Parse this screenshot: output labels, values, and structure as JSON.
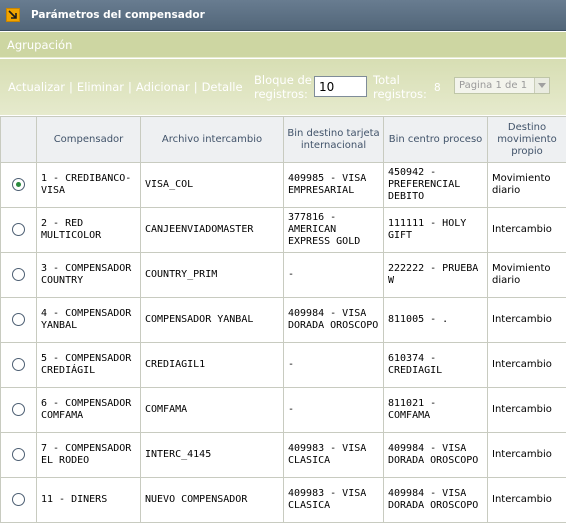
{
  "window": {
    "title": "Parámetros del compensador",
    "icon": "corner-arrow-icon"
  },
  "grouping": {
    "label": "Agrupación"
  },
  "toolbar": {
    "actualizar": "Actualizar",
    "eliminar": "Eliminar",
    "adicionar": "Adicionar",
    "detalle": "Detalle",
    "separator": "|",
    "block_label_1": "Bloque de",
    "block_label_2": "registros:",
    "block_value": "10",
    "total_label_1": "Total",
    "total_label_2": "registros:",
    "total_value": "8",
    "pager_value": "Pagina 1 de 1"
  },
  "table": {
    "headers": {
      "compensador": "Compensador",
      "archivo": "Archivo intercambio",
      "bin_destino": "Bin destino tarjeta internacional",
      "bin_centro": "Bin centro proceso",
      "destino_mov": "Destino movimiento propio"
    },
    "rows": [
      {
        "selected": true,
        "compensador": "1 - CREDIBANCO-VISA",
        "archivo": "VISA_COL",
        "bin_destino": "409985 - VISA EMPRESARIAL",
        "bin_centro": "450942 - PREFERENCIAL DEBITO",
        "destino": "Movimiento diario"
      },
      {
        "selected": false,
        "compensador": "2 - RED MULTICOLOR",
        "archivo": "CANJEENVIADOMASTER",
        "bin_destino": "377816 - AMERICAN EXPRESS GOLD",
        "bin_centro": "111111 - HOLY GIFT",
        "destino": "Intercambio"
      },
      {
        "selected": false,
        "compensador": "3 - COMPENSADOR COUNTRY",
        "archivo": "COUNTRY_PRIM",
        "bin_destino": "-",
        "bin_centro": "222222 - PRUEBA W",
        "destino": "Movimiento diario"
      },
      {
        "selected": false,
        "compensador": "4 - COMPENSADOR YANBAL",
        "archivo": "COMPENSADOR YANBAL",
        "bin_destino": "409984 - VISA DORADA OROSCOPO",
        "bin_centro": "811005 - .",
        "destino": "Intercambio"
      },
      {
        "selected": false,
        "compensador": "5 - COMPENSADOR CREDIÁGIL",
        "archivo": "CREDIAGIL1",
        "bin_destino": "-",
        "bin_centro": "610374 - CREDIAGIL",
        "destino": "Intercambio"
      },
      {
        "selected": false,
        "compensador": "6 - COMPENSADOR COMFAMA",
        "archivo": "COMFAMA",
        "bin_destino": "-",
        "bin_centro": "811021 - COMFAMA",
        "destino": "Intercambio"
      },
      {
        "selected": false,
        "compensador": "7 - COMPENSADOR EL RODEO",
        "archivo": "INTERC_4145",
        "bin_destino": "409983 - VISA CLASICA",
        "bin_centro": "409984 - VISA DORADA OROSCOPO",
        "destino": "Intercambio"
      },
      {
        "selected": false,
        "compensador": "11 - DINERS",
        "archivo": "NUEVO COMPENSADOR",
        "bin_destino": "409983 - VISA CLASICA",
        "bin_centro": "409984 - VISA DORADA OROSCOPO",
        "destino": "Intercambio"
      }
    ]
  }
}
